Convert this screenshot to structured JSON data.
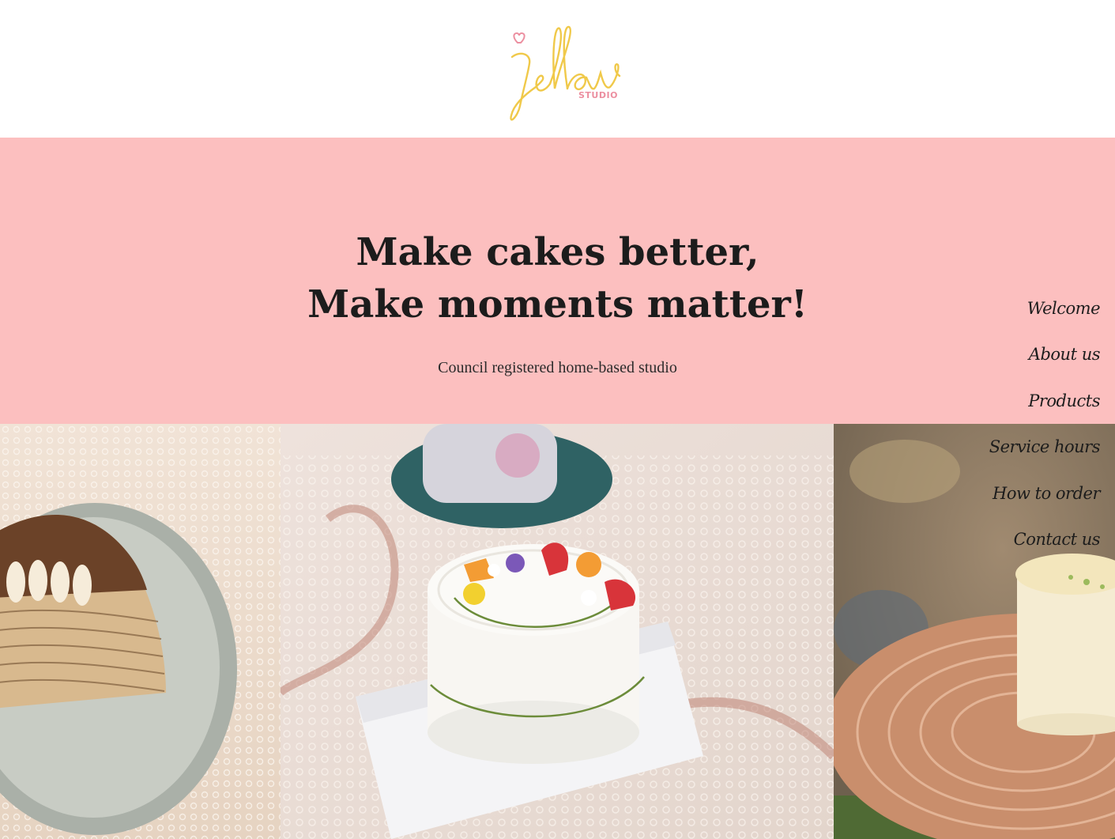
{
  "brand": {
    "logo_text": "Jellow",
    "logo_sub": "STUDIO",
    "logo_color": "#f0c94a",
    "heart_color": "#ec8fa0"
  },
  "hero": {
    "headline_line1": "Make cakes better,",
    "headline_line2": "Make moments matter!",
    "subline": "Council registered home-based studio",
    "background": "#fcbfbf"
  },
  "nav": {
    "items": [
      {
        "label": "Welcome"
      },
      {
        "label": "About us"
      },
      {
        "label": "Products"
      },
      {
        "label": "Service hours"
      },
      {
        "label": "How to order"
      },
      {
        "label": "Contact us"
      }
    ]
  },
  "gallery": {
    "images": [
      {
        "icon": "crepe-cake-photo"
      },
      {
        "icon": "fruit-cream-cake-photo"
      },
      {
        "icon": "cheesecake-photo"
      }
    ]
  }
}
